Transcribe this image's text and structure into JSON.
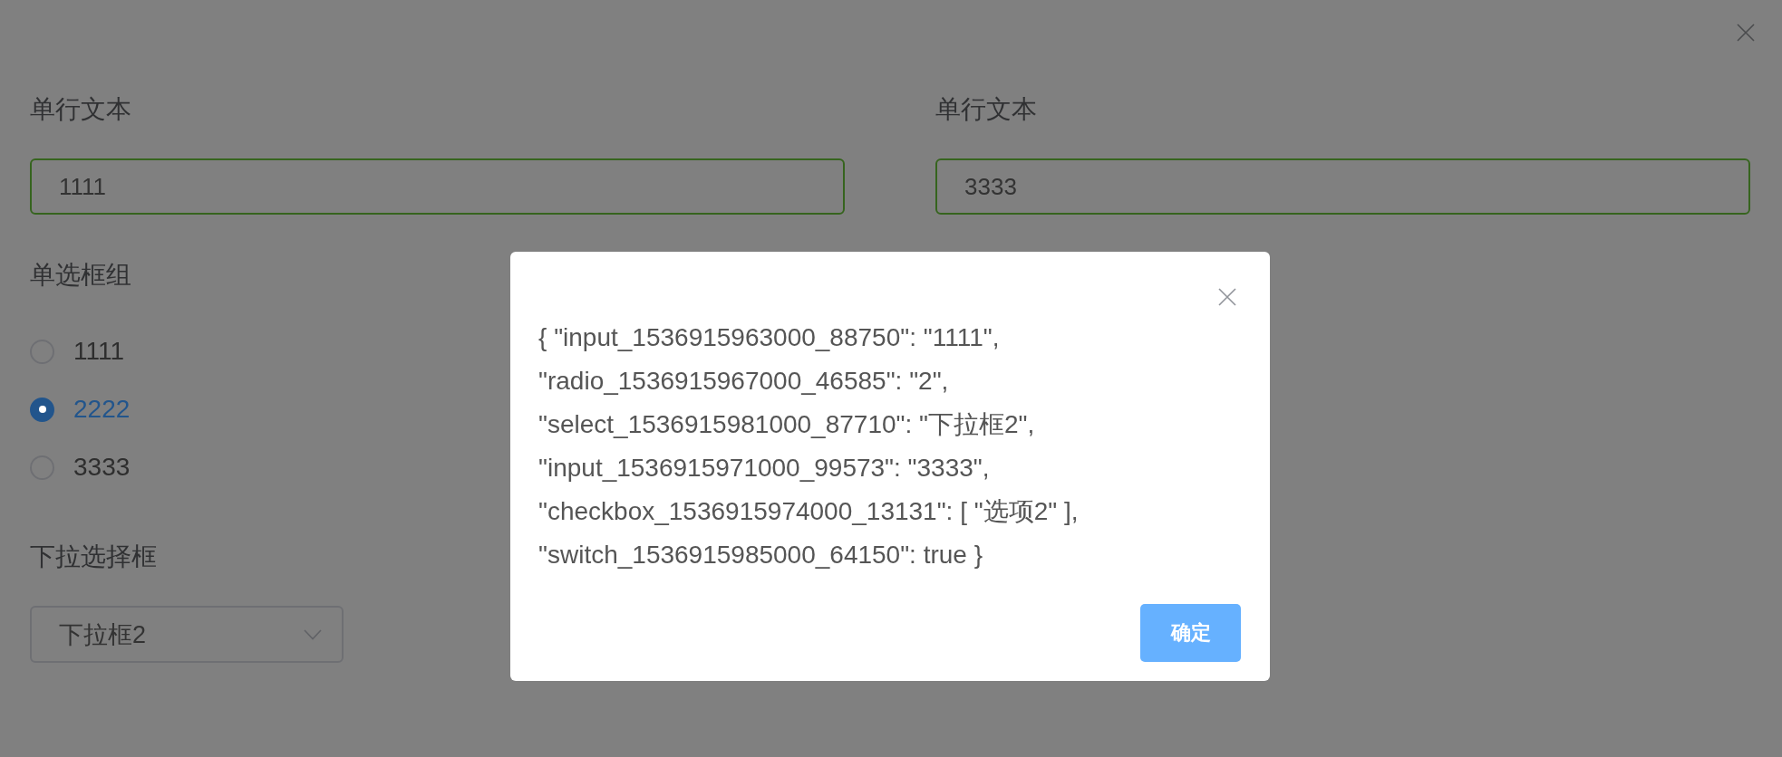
{
  "form": {
    "columns": [
      {
        "fields": [
          {
            "kind": "text",
            "label": "单行文本",
            "value": "1111",
            "validated": true
          },
          {
            "kind": "radio",
            "label": "单选框组",
            "options": [
              {
                "label": "1111",
                "selected": false
              },
              {
                "label": "2222",
                "selected": true
              },
              {
                "label": "3333",
                "selected": false
              }
            ]
          },
          {
            "kind": "select",
            "label": "下拉选择框",
            "value": "下拉框2"
          }
        ]
      },
      {
        "fields": [
          {
            "kind": "text",
            "label": "单行文本",
            "value": "3333",
            "validated": true
          }
        ]
      }
    ]
  },
  "dialog": {
    "message_lines": [
      "{ \"input_1536915963000_88750\": \"1111\",",
      "\"radio_1536915967000_46585\": \"2\",",
      "\"select_1536915981000_87710\": \"下拉框2\",",
      "\"input_1536915971000_99573\": \"3333\",",
      "\"checkbox_1536915974000_13131\": [ \"选项2\" ],",
      "\"switch_1536915985000_64150\": true }"
    ],
    "confirm_button": "确定"
  }
}
